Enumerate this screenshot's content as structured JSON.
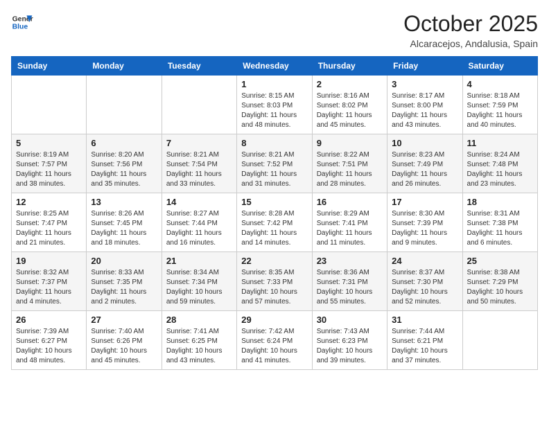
{
  "header": {
    "logo_general": "General",
    "logo_blue": "Blue",
    "month_year": "October 2025",
    "location": "Alcaracejos, Andalusia, Spain"
  },
  "weekdays": [
    "Sunday",
    "Monday",
    "Tuesday",
    "Wednesday",
    "Thursday",
    "Friday",
    "Saturday"
  ],
  "weeks": [
    [
      {
        "day": "",
        "info": ""
      },
      {
        "day": "",
        "info": ""
      },
      {
        "day": "",
        "info": ""
      },
      {
        "day": "1",
        "info": "Sunrise: 8:15 AM\nSunset: 8:03 PM\nDaylight: 11 hours\nand 48 minutes."
      },
      {
        "day": "2",
        "info": "Sunrise: 8:16 AM\nSunset: 8:02 PM\nDaylight: 11 hours\nand 45 minutes."
      },
      {
        "day": "3",
        "info": "Sunrise: 8:17 AM\nSunset: 8:00 PM\nDaylight: 11 hours\nand 43 minutes."
      },
      {
        "day": "4",
        "info": "Sunrise: 8:18 AM\nSunset: 7:59 PM\nDaylight: 11 hours\nand 40 minutes."
      }
    ],
    [
      {
        "day": "5",
        "info": "Sunrise: 8:19 AM\nSunset: 7:57 PM\nDaylight: 11 hours\nand 38 minutes."
      },
      {
        "day": "6",
        "info": "Sunrise: 8:20 AM\nSunset: 7:56 PM\nDaylight: 11 hours\nand 35 minutes."
      },
      {
        "day": "7",
        "info": "Sunrise: 8:21 AM\nSunset: 7:54 PM\nDaylight: 11 hours\nand 33 minutes."
      },
      {
        "day": "8",
        "info": "Sunrise: 8:21 AM\nSunset: 7:52 PM\nDaylight: 11 hours\nand 31 minutes."
      },
      {
        "day": "9",
        "info": "Sunrise: 8:22 AM\nSunset: 7:51 PM\nDaylight: 11 hours\nand 28 minutes."
      },
      {
        "day": "10",
        "info": "Sunrise: 8:23 AM\nSunset: 7:49 PM\nDaylight: 11 hours\nand 26 minutes."
      },
      {
        "day": "11",
        "info": "Sunrise: 8:24 AM\nSunset: 7:48 PM\nDaylight: 11 hours\nand 23 minutes."
      }
    ],
    [
      {
        "day": "12",
        "info": "Sunrise: 8:25 AM\nSunset: 7:47 PM\nDaylight: 11 hours\nand 21 minutes."
      },
      {
        "day": "13",
        "info": "Sunrise: 8:26 AM\nSunset: 7:45 PM\nDaylight: 11 hours\nand 18 minutes."
      },
      {
        "day": "14",
        "info": "Sunrise: 8:27 AM\nSunset: 7:44 PM\nDaylight: 11 hours\nand 16 minutes."
      },
      {
        "day": "15",
        "info": "Sunrise: 8:28 AM\nSunset: 7:42 PM\nDaylight: 11 hours\nand 14 minutes."
      },
      {
        "day": "16",
        "info": "Sunrise: 8:29 AM\nSunset: 7:41 PM\nDaylight: 11 hours\nand 11 minutes."
      },
      {
        "day": "17",
        "info": "Sunrise: 8:30 AM\nSunset: 7:39 PM\nDaylight: 11 hours\nand 9 minutes."
      },
      {
        "day": "18",
        "info": "Sunrise: 8:31 AM\nSunset: 7:38 PM\nDaylight: 11 hours\nand 6 minutes."
      }
    ],
    [
      {
        "day": "19",
        "info": "Sunrise: 8:32 AM\nSunset: 7:37 PM\nDaylight: 11 hours\nand 4 minutes."
      },
      {
        "day": "20",
        "info": "Sunrise: 8:33 AM\nSunset: 7:35 PM\nDaylight: 11 hours\nand 2 minutes."
      },
      {
        "day": "21",
        "info": "Sunrise: 8:34 AM\nSunset: 7:34 PM\nDaylight: 10 hours\nand 59 minutes."
      },
      {
        "day": "22",
        "info": "Sunrise: 8:35 AM\nSunset: 7:33 PM\nDaylight: 10 hours\nand 57 minutes."
      },
      {
        "day": "23",
        "info": "Sunrise: 8:36 AM\nSunset: 7:31 PM\nDaylight: 10 hours\nand 55 minutes."
      },
      {
        "day": "24",
        "info": "Sunrise: 8:37 AM\nSunset: 7:30 PM\nDaylight: 10 hours\nand 52 minutes."
      },
      {
        "day": "25",
        "info": "Sunrise: 8:38 AM\nSunset: 7:29 PM\nDaylight: 10 hours\nand 50 minutes."
      }
    ],
    [
      {
        "day": "26",
        "info": "Sunrise: 7:39 AM\nSunset: 6:27 PM\nDaylight: 10 hours\nand 48 minutes."
      },
      {
        "day": "27",
        "info": "Sunrise: 7:40 AM\nSunset: 6:26 PM\nDaylight: 10 hours\nand 45 minutes."
      },
      {
        "day": "28",
        "info": "Sunrise: 7:41 AM\nSunset: 6:25 PM\nDaylight: 10 hours\nand 43 minutes."
      },
      {
        "day": "29",
        "info": "Sunrise: 7:42 AM\nSunset: 6:24 PM\nDaylight: 10 hours\nand 41 minutes."
      },
      {
        "day": "30",
        "info": "Sunrise: 7:43 AM\nSunset: 6:23 PM\nDaylight: 10 hours\nand 39 minutes."
      },
      {
        "day": "31",
        "info": "Sunrise: 7:44 AM\nSunset: 6:21 PM\nDaylight: 10 hours\nand 37 minutes."
      },
      {
        "day": "",
        "info": ""
      }
    ]
  ]
}
